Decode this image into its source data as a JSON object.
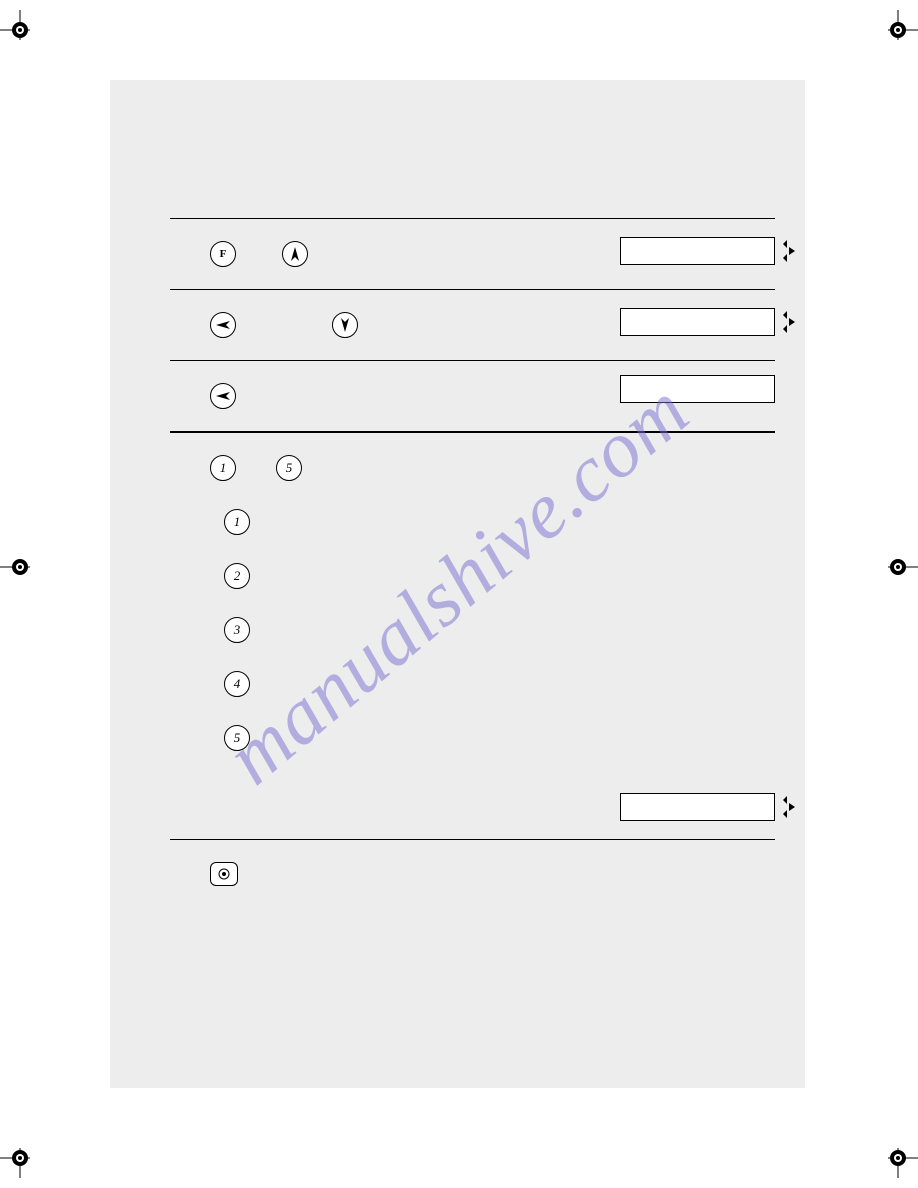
{
  "watermark": "manualshive.com",
  "icons": {
    "f": "F",
    "num1": "1",
    "num2": "2",
    "num3": "3",
    "num4": "4",
    "num5": "5"
  }
}
